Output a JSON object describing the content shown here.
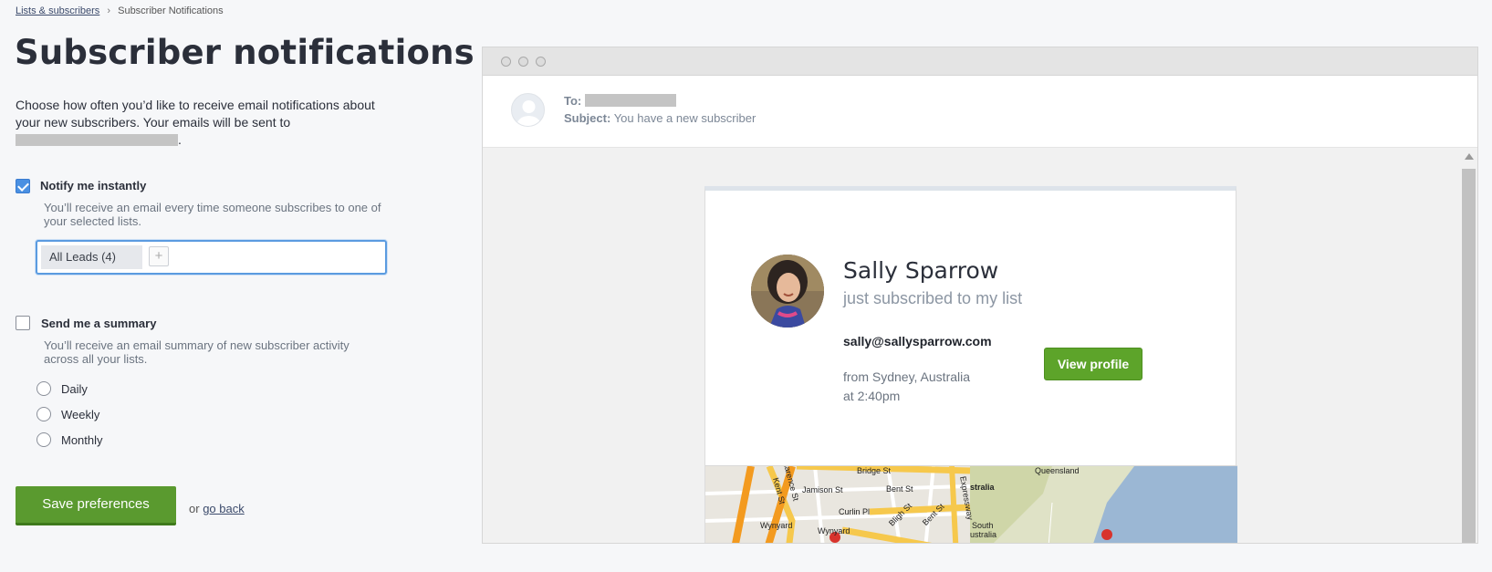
{
  "breadcrumb": {
    "parent": "Lists & subscribers",
    "separator": "›",
    "current": "Subscriber Notifications"
  },
  "page": {
    "title": "Subscriber notifications",
    "intro": "Choose how often you’d like to receive email notifications about your new subscribers. Your emails will be sent to",
    "intro_end": "."
  },
  "instant": {
    "label": "Notify me instantly",
    "description": "You’ll receive an email every time someone subscribes to one of your selected lists.",
    "checked": true,
    "tags": [
      "All Leads (4)"
    ],
    "add_icon": "plus-icon"
  },
  "summary": {
    "label": "Send me a summary",
    "description": "You’ll receive an email summary of new subscriber activity across all your lists.",
    "checked": false,
    "options": [
      "Daily",
      "Weekly",
      "Monthly"
    ]
  },
  "actions": {
    "save_label": "Save preferences",
    "or_text": "or",
    "back_label": "go back"
  },
  "preview": {
    "to_label": "To:",
    "subject_label": "Subject:",
    "subject": "You have a new subscriber",
    "subscriber": {
      "name": "Sally Sparrow",
      "tagline": "just subscribed to my list",
      "email": "sally@sallysparrow.com",
      "location": "from Sydney, Australia",
      "time": "at 2:40pm",
      "button_label": "View profile"
    },
    "map_labels": {
      "bridge": "Bridge St",
      "jamison": "Jamison St",
      "kent": "Kent St",
      "clarence": "Clarence St",
      "bent": "Bent St",
      "curlin": "Curlin Pl",
      "wynyard_stn": "Wynyard",
      "wynyard": "Wynyard",
      "bligh": "Bligh St",
      "bent2": "Bent St",
      "express": "Expressway",
      "queensland": "Queensland",
      "nsw": "stralia",
      "south": "South",
      "ustralia": "ustralia"
    }
  },
  "colors": {
    "accent": "#4a90e2",
    "save": "#5a9a2f",
    "view": "#5da42a"
  }
}
